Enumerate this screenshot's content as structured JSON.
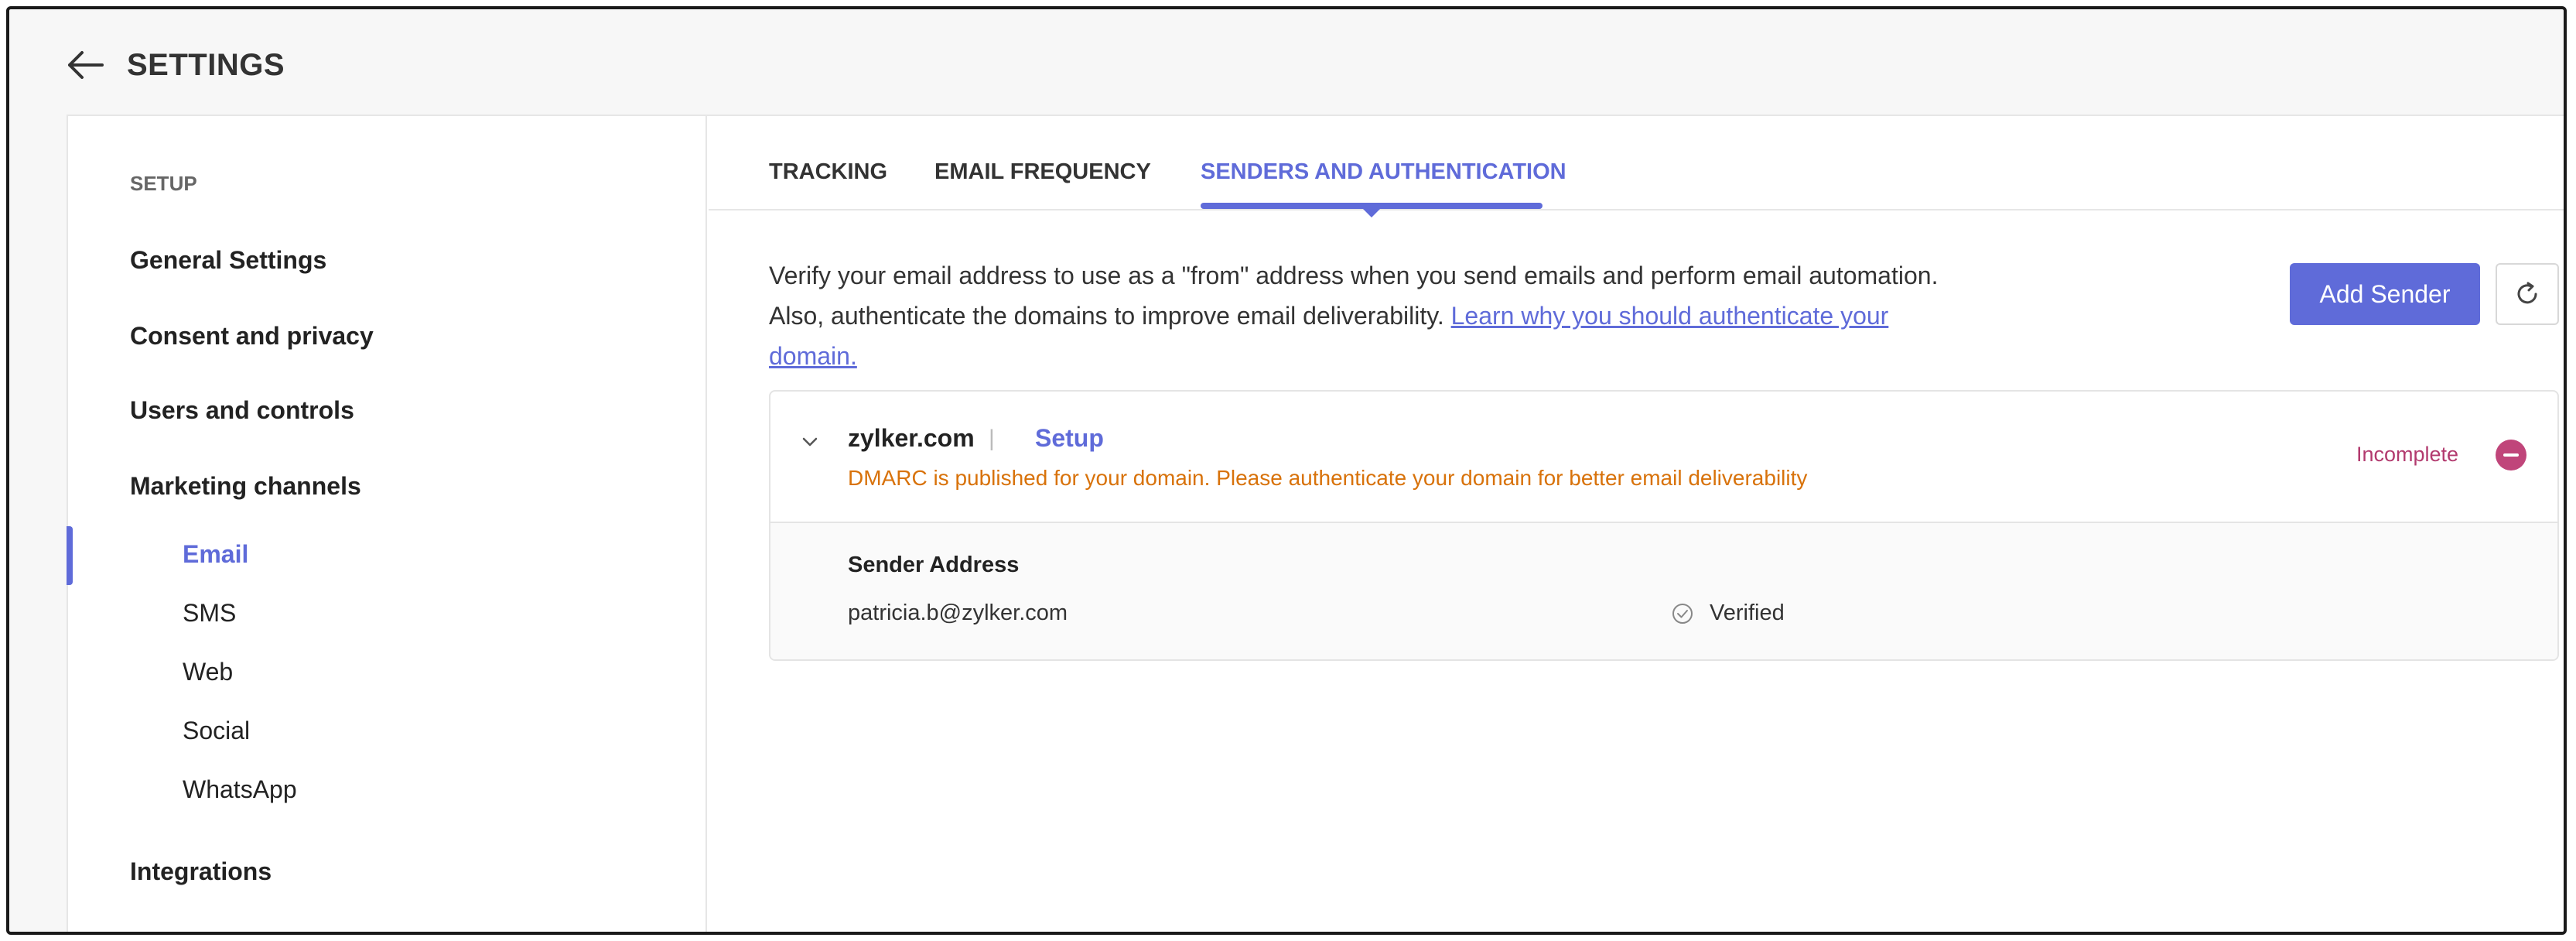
{
  "header": {
    "title": "SETTINGS"
  },
  "sidebar": {
    "section_label": "SETUP",
    "items": [
      {
        "label": "General Settings"
      },
      {
        "label": "Consent and privacy"
      },
      {
        "label": "Users and controls"
      },
      {
        "label": "Marketing channels"
      }
    ],
    "channels": [
      {
        "label": "Email",
        "active": true
      },
      {
        "label": "SMS"
      },
      {
        "label": "Web"
      },
      {
        "label": "Social"
      },
      {
        "label": "WhatsApp"
      }
    ],
    "integrations": "Integrations"
  },
  "tabs": [
    {
      "label": "TRACKING"
    },
    {
      "label": "EMAIL FREQUENCY"
    },
    {
      "label": "SENDERS AND AUTHENTICATION",
      "active": true
    }
  ],
  "description": {
    "text": "Verify your email address to use as a \"from\" address when you send emails and perform email automation. Also, authenticate the domains to improve email deliverability.",
    "link": "Learn why you should authenticate your domain."
  },
  "actions": {
    "add_sender": "Add Sender"
  },
  "domain": {
    "name": "zylker.com",
    "separator": "|",
    "setup_link": "Setup",
    "warning": "DMARC is published for your domain. Please authenticate your domain for better email deliverability",
    "status": "Incomplete",
    "status_color": "#c0457a",
    "sender_header": "Sender Address",
    "sender_email": "patricia.b@zylker.com",
    "sender_status": "Verified"
  },
  "colors": {
    "accent": "#5f6bd9",
    "warning": "#d8720a"
  }
}
